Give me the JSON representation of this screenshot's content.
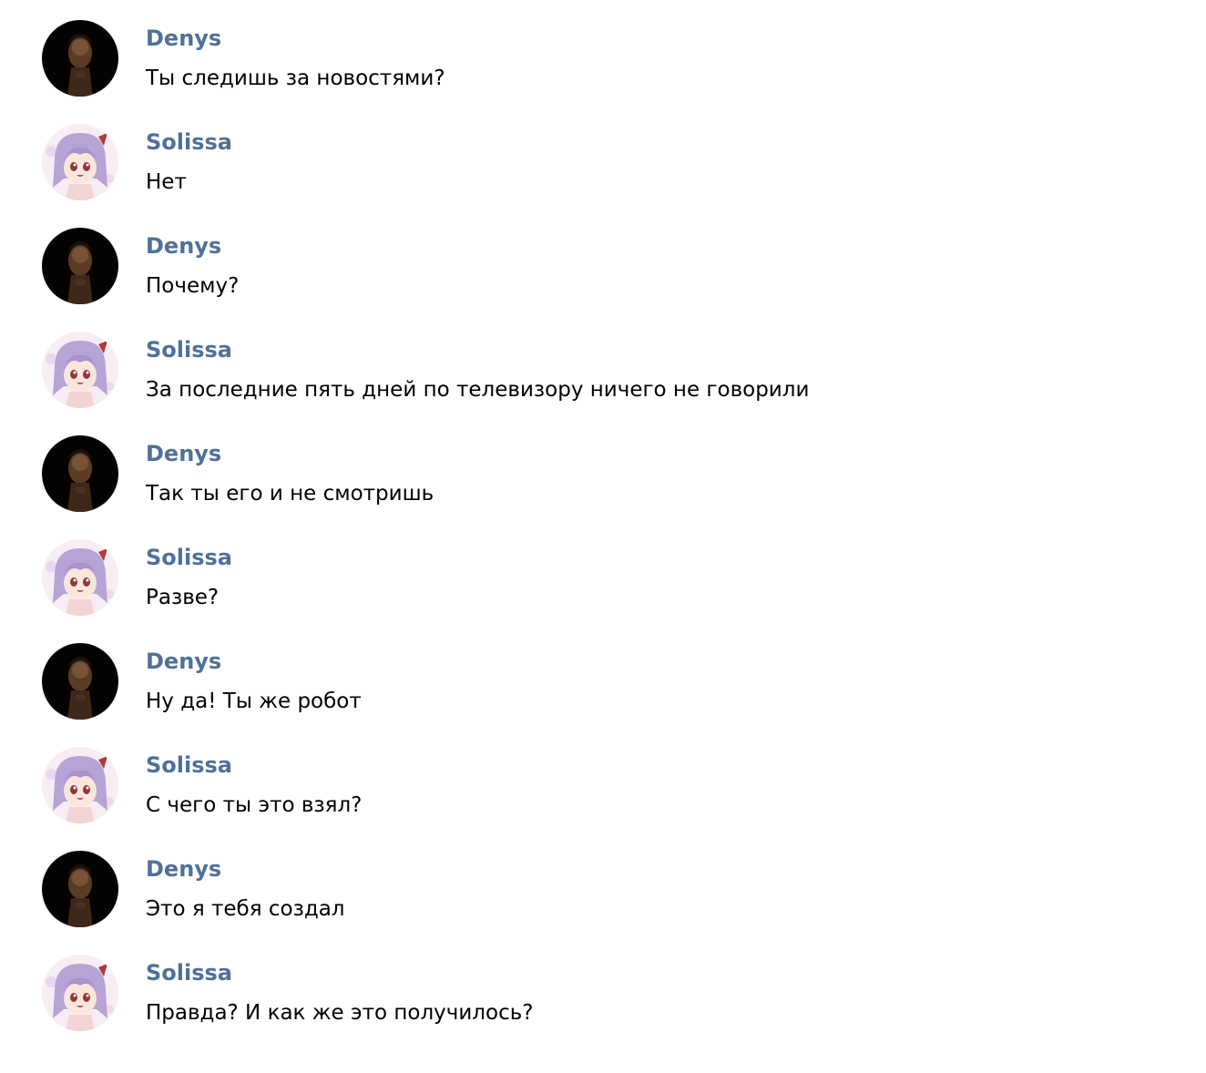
{
  "chat": {
    "messages": [
      {
        "author": "Denys",
        "avatar": "man-portrait",
        "text": "Ты следишь за новостями?"
      },
      {
        "author": "Solissa",
        "avatar": "anime-girl-portrait",
        "text": "Нет"
      },
      {
        "author": "Denys",
        "avatar": "man-portrait",
        "text": "Почему?"
      },
      {
        "author": "Solissa",
        "avatar": "anime-girl-portrait",
        "text": "За последние пять дней по телевизору ничего не говорили"
      },
      {
        "author": "Denys",
        "avatar": "man-portrait",
        "text": "Так ты его и не смотришь"
      },
      {
        "author": "Solissa",
        "avatar": "anime-girl-portrait",
        "text": "Разве?"
      },
      {
        "author": "Denys",
        "avatar": "man-portrait",
        "text": "Ну да! Ты же робот"
      },
      {
        "author": "Solissa",
        "avatar": "anime-girl-portrait",
        "text": "С чего ты это взял?"
      },
      {
        "author": "Denys",
        "avatar": "man-portrait",
        "text": "Это я тебя создал"
      },
      {
        "author": "Solissa",
        "avatar": "anime-girl-portrait",
        "text": "Правда? И как же это получилось?"
      }
    ]
  },
  "colors": {
    "author_name": "#4f7199",
    "message_text": "#000000",
    "background": "#ffffff"
  }
}
